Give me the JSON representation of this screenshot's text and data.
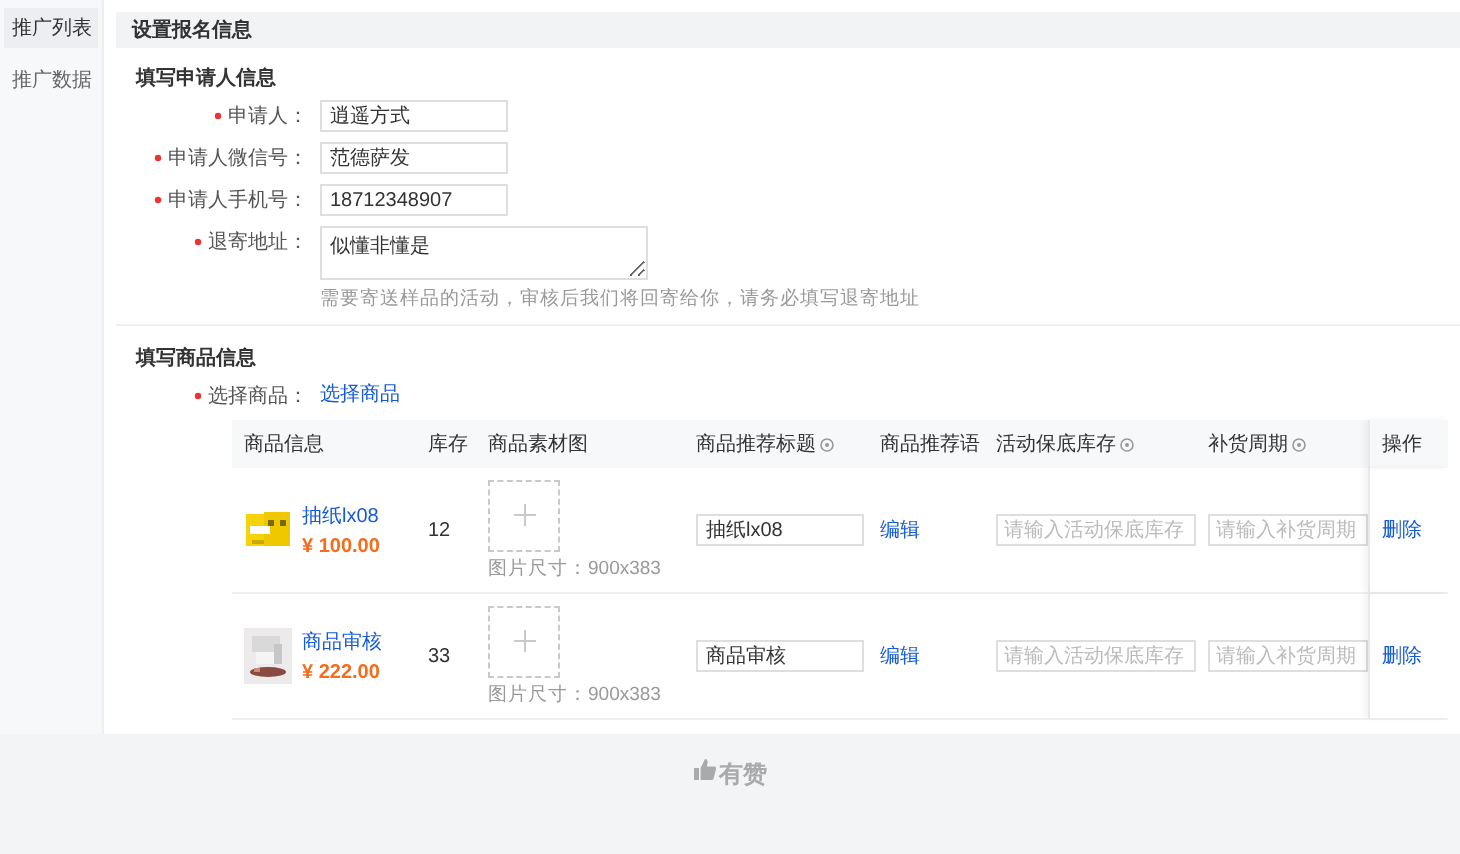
{
  "sidebar": {
    "items": [
      {
        "label": "推广列表",
        "selected": true
      },
      {
        "label": "推广数据",
        "selected": false
      }
    ]
  },
  "page_title": "设置报名信息",
  "applicant_section": {
    "title": "填写申请人信息",
    "fields": [
      {
        "label": "申请人：",
        "required": true,
        "kind": "input",
        "value": "逍遥方式"
      },
      {
        "label": "申请人微信号：",
        "required": true,
        "kind": "input",
        "value": "范德萨发"
      },
      {
        "label": "申请人手机号：",
        "required": true,
        "kind": "input",
        "value": "18712348907"
      },
      {
        "label": "退寄地址：",
        "required": true,
        "kind": "textarea",
        "value": "似懂非懂是",
        "hint": "需要寄送样品的活动，审核后我们将回寄给你，请务必填写退寄地址"
      }
    ]
  },
  "product_section": {
    "title": "填写商品信息",
    "select_label": "选择商品：",
    "select_required": true,
    "select_link": "选择商品",
    "table": {
      "columns": [
        {
          "label": "商品信息",
          "info": false
        },
        {
          "label": "库存",
          "info": false
        },
        {
          "label": "商品素材图",
          "info": false
        },
        {
          "label": "商品推荐标题",
          "info": true
        },
        {
          "label": "商品推荐语",
          "info": false
        },
        {
          "label": "活动保底库存",
          "info": true
        },
        {
          "label": "补货周期",
          "info": true
        },
        {
          "label": "操作",
          "info": false
        }
      ],
      "rows": [
        {
          "name": "抽纸lx08",
          "price": "¥ 100.00",
          "stock": "12",
          "image_hint": "图片尺寸：900x383",
          "title_value": "抽纸lx08",
          "recommend_link": "编辑",
          "base_stock_placeholder": "请输入活动保底库存",
          "period_placeholder": "请输入补货周期",
          "action": "删除"
        },
        {
          "name": "商品审核",
          "price": "¥ 222.00",
          "stock": "33",
          "image_hint": "图片尺寸：900x383",
          "title_value": "商品审核",
          "recommend_link": "编辑",
          "base_stock_placeholder": "请输入活动保底库存",
          "period_placeholder": "请输入补货周期",
          "action": "删除"
        }
      ]
    }
  },
  "footer": {
    "brand": "有赞"
  }
}
